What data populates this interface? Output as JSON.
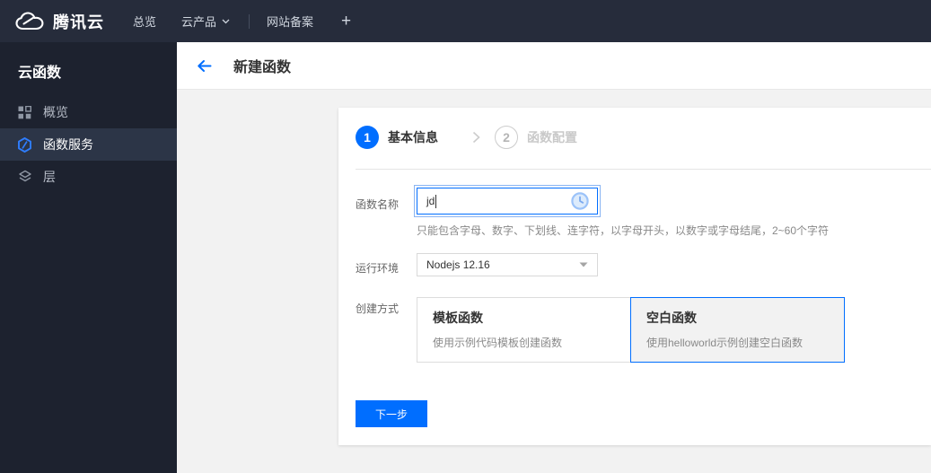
{
  "topnav": {
    "brand": "腾讯云",
    "overview": "总览",
    "products": "云产品",
    "beian": "网站备案",
    "add": "+"
  },
  "sidebar": {
    "title": "云函数",
    "items": [
      {
        "label": "概览",
        "icon": "grid-icon"
      },
      {
        "label": "函数服务",
        "icon": "scf-hexagon-icon"
      },
      {
        "label": "层",
        "icon": "layers-icon"
      }
    ]
  },
  "header": {
    "title": "新建函数"
  },
  "wizard": {
    "step1_num": "1",
    "step1_label": "基本信息",
    "step2_num": "2",
    "step2_label": "函数配置"
  },
  "form": {
    "name_label": "函数名称",
    "name_value": "jd",
    "name_hint": "只能包含字母、数字、下划线、连字符，以字母开头，以数字或字母结尾，2~60个字符",
    "runtime_label": "运行环境",
    "runtime_value": "Nodejs 12.16",
    "method_label": "创建方式",
    "options": [
      {
        "title": "模板函数",
        "desc": "使用示例代码模板创建函数",
        "selected": false
      },
      {
        "title": "空白函数",
        "desc": "使用helloworld示例创建空白函数",
        "selected": true
      }
    ]
  },
  "footer": {
    "next": "下一步"
  },
  "colors": {
    "accent": "#006eff",
    "topnav_bg": "#262c3b",
    "sidebar_bg": "#1d222f",
    "sidebar_active_bg": "#2c3547",
    "page_bg": "#f2f2f2"
  }
}
